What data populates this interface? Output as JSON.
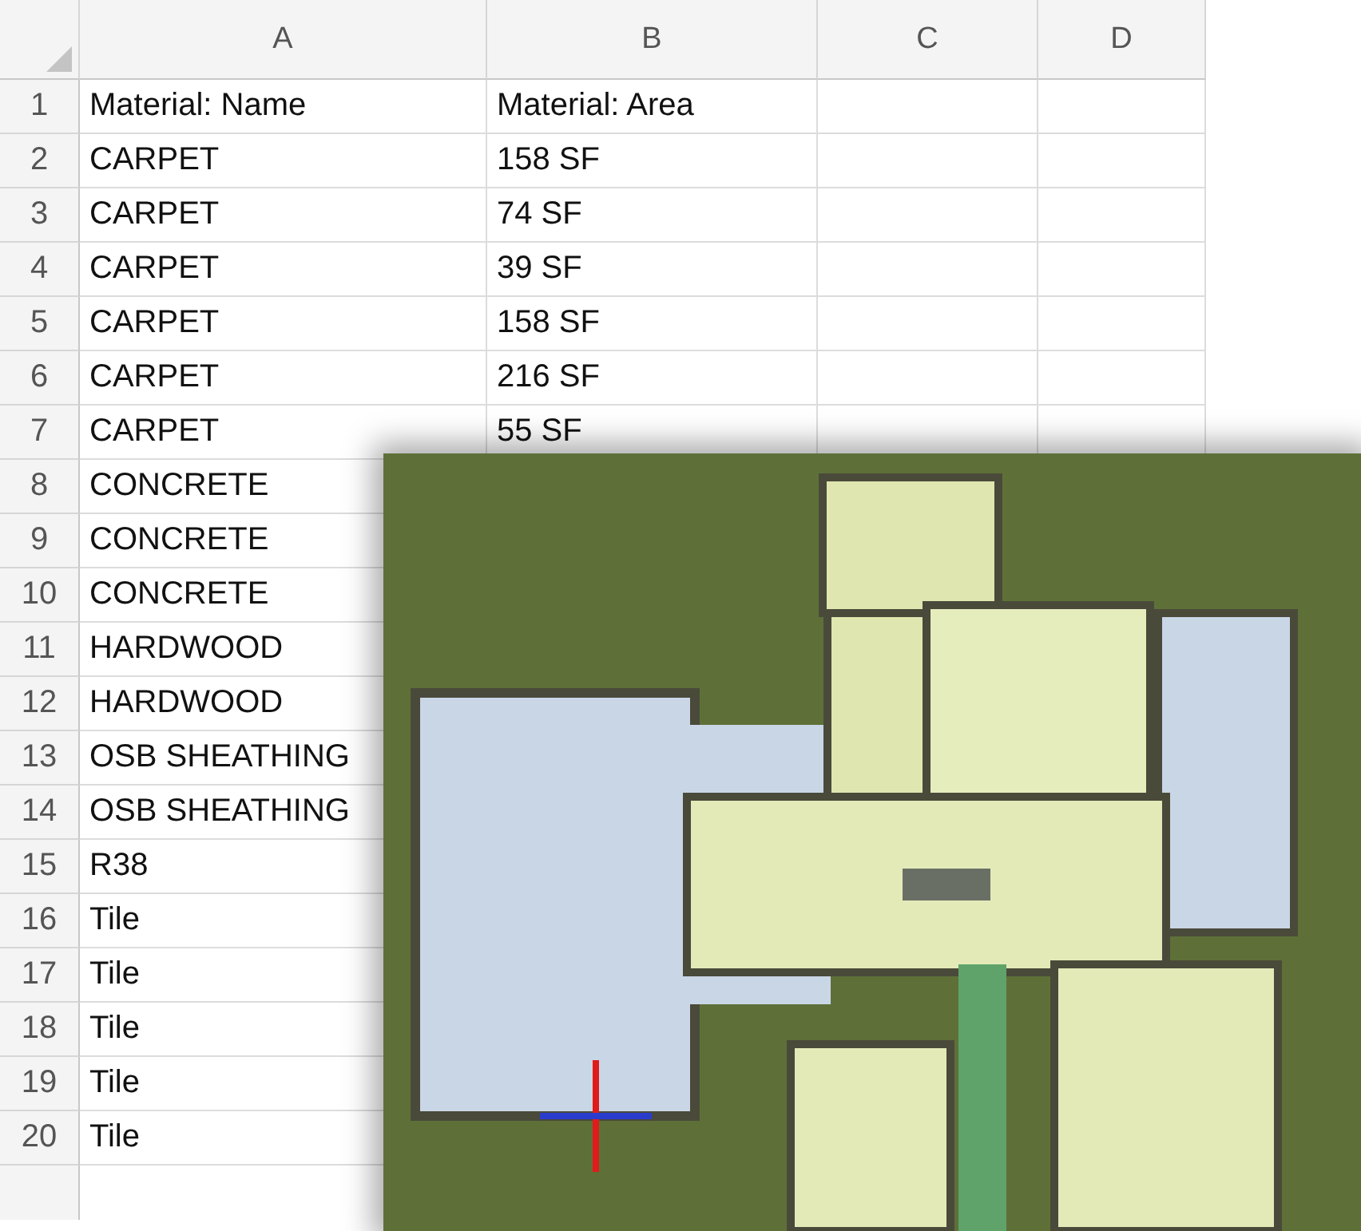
{
  "sheet": {
    "columns": [
      "A",
      "B",
      "C",
      "D"
    ],
    "rows": [
      {
        "number": "1",
        "cells": [
          "Material: Name",
          "Material: Area"
        ]
      },
      {
        "number": "2",
        "cells": [
          "CARPET",
          "158 SF"
        ]
      },
      {
        "number": "3",
        "cells": [
          "CARPET",
          "74 SF"
        ]
      },
      {
        "number": "4",
        "cells": [
          "CARPET",
          "39 SF"
        ]
      },
      {
        "number": "5",
        "cells": [
          "CARPET",
          "158 SF"
        ]
      },
      {
        "number": "6",
        "cells": [
          "CARPET",
          "216 SF"
        ]
      },
      {
        "number": "7",
        "cells": [
          "CARPET",
          "55 SF"
        ]
      },
      {
        "number": "8",
        "cells": [
          "CONCRETE"
        ]
      },
      {
        "number": "9",
        "cells": [
          "CONCRETE"
        ]
      },
      {
        "number": "10",
        "cells": [
          "CONCRETE"
        ]
      },
      {
        "number": "11",
        "cells": [
          "HARDWOOD"
        ]
      },
      {
        "number": "12",
        "cells": [
          "HARDWOOD"
        ]
      },
      {
        "number": "13",
        "cells": [
          "OSB SHEATHING"
        ]
      },
      {
        "number": "14",
        "cells": [
          "OSB SHEATHING"
        ]
      },
      {
        "number": "15",
        "cells": [
          "R38"
        ]
      },
      {
        "number": "16",
        "cells": [
          "Tile"
        ]
      },
      {
        "number": "17",
        "cells": [
          "Tile"
        ]
      },
      {
        "number": "18",
        "cells": [
          "Tile"
        ]
      },
      {
        "number": "19",
        "cells": [
          "Tile"
        ]
      },
      {
        "number": "20",
        "cells": [
          "Tile"
        ]
      }
    ]
  }
}
